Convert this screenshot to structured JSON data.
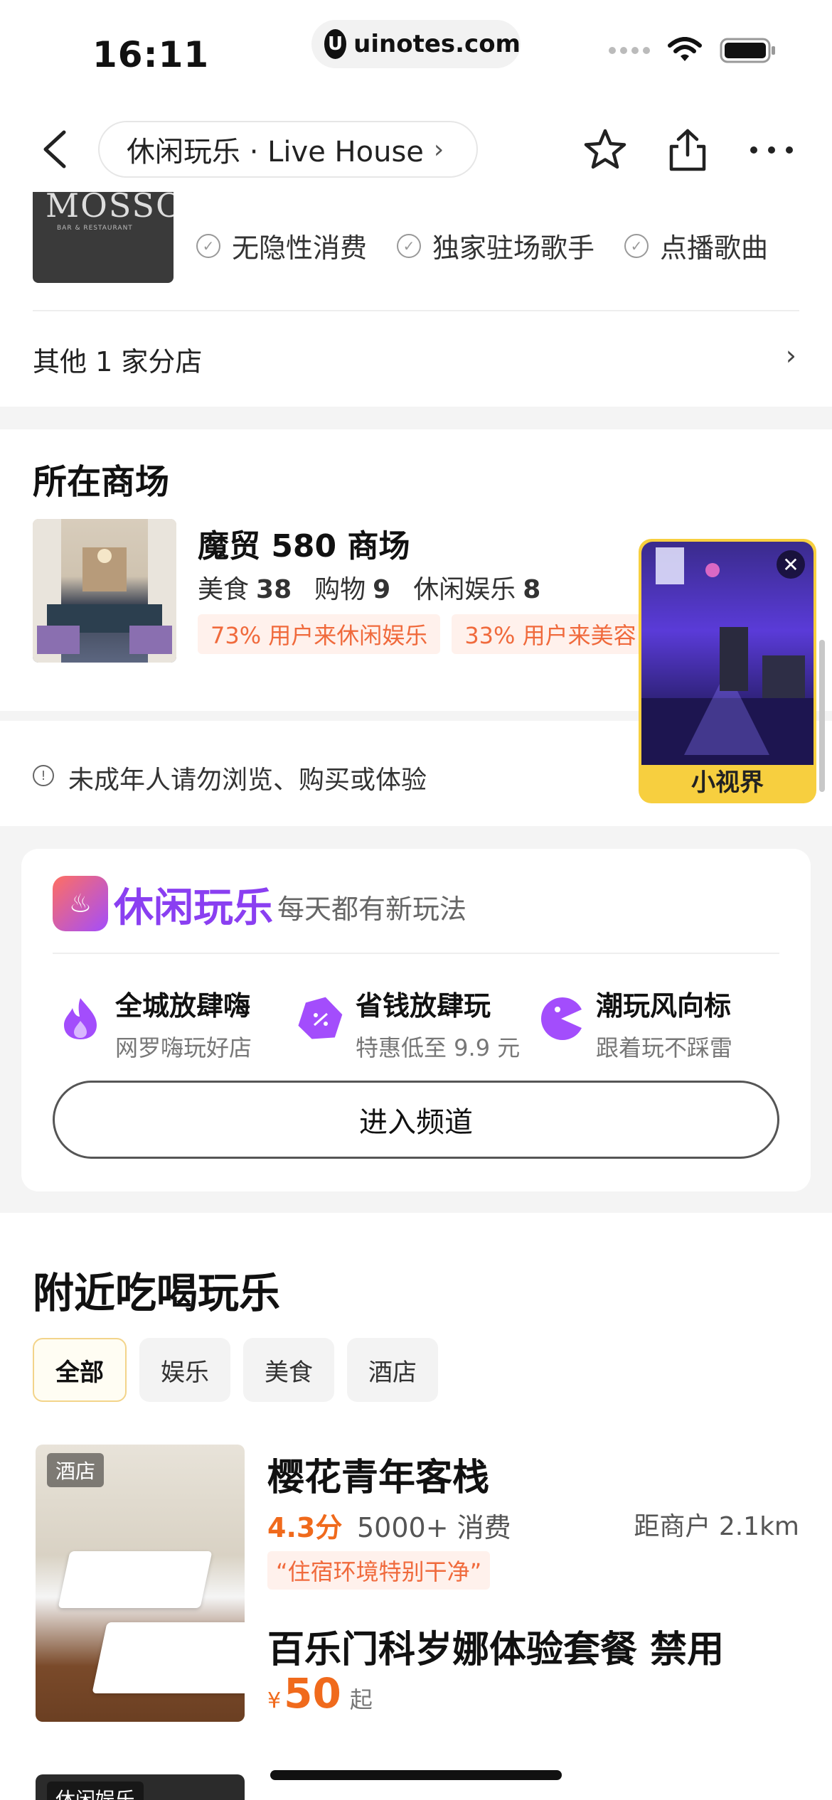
{
  "status_bar": {
    "time": "16:11",
    "url_logo": "U",
    "url": "uinotes.com"
  },
  "nav": {
    "breadcrumb": "休闲玩乐 · Live House",
    "chevron": "›"
  },
  "store": {
    "logo_text": "MOSSO",
    "logo_sub": "BAR & RESTAURANT",
    "tags": [
      "无隐性消费",
      "独家驻场歌手",
      "点播歌曲"
    ],
    "branch_text": "其他 1 家分店",
    "branch_chevron": "›"
  },
  "mall": {
    "section_title": "所在商场",
    "name": "魔贸 580 商场",
    "stats": [
      {
        "label": "美食",
        "value": "38"
      },
      {
        "label": "购物",
        "value": "9"
      },
      {
        "label": "休闲娱乐",
        "value": "8"
      }
    ],
    "badges": [
      "73% 用户来休闲娱乐",
      "33% 用户来美容"
    ]
  },
  "notice": {
    "icon": "!",
    "text": "未成年人请勿浏览、购买或体验"
  },
  "channel": {
    "logo_glyph": "♨",
    "name": "休闲玩乐",
    "slogan": "每天都有新玩法",
    "features": [
      {
        "title": "全城放肆嗨",
        "sub": "网罗嗨玩好店",
        "icon": "flame-icon"
      },
      {
        "title": "省钱放肆玩",
        "sub": "特惠低至 9.9 元",
        "icon": "coupon-icon"
      },
      {
        "title": "潮玩风向标",
        "sub": "跟着玩不踩雷",
        "icon": "pacman-icon"
      }
    ],
    "button": "进入频道",
    "accent": "#8a3ff1"
  },
  "nearby": {
    "title": "附近吃喝玩乐",
    "chips": [
      "全部",
      "娱乐",
      "美食",
      "酒店"
    ],
    "items": [
      {
        "tag": "酒店",
        "name": "樱花青年客栈",
        "score": "4.3分",
        "spend": "5000+ 消费",
        "distance": "距商户 2.1km",
        "quote": "“住宿环境特别干净”",
        "price_currency": "¥",
        "price": "50",
        "price_suffix": "起"
      },
      {
        "tag": "休闲娱乐",
        "name": "百乐门科岁娜体验套餐 禁用"
      }
    ]
  },
  "mini_video": {
    "label": "小视界",
    "close": "✕"
  },
  "colors": {
    "orange": "#f06a1c",
    "badge_bg": "#fff1ec",
    "mini_video_frame": "#f7cf3f"
  }
}
